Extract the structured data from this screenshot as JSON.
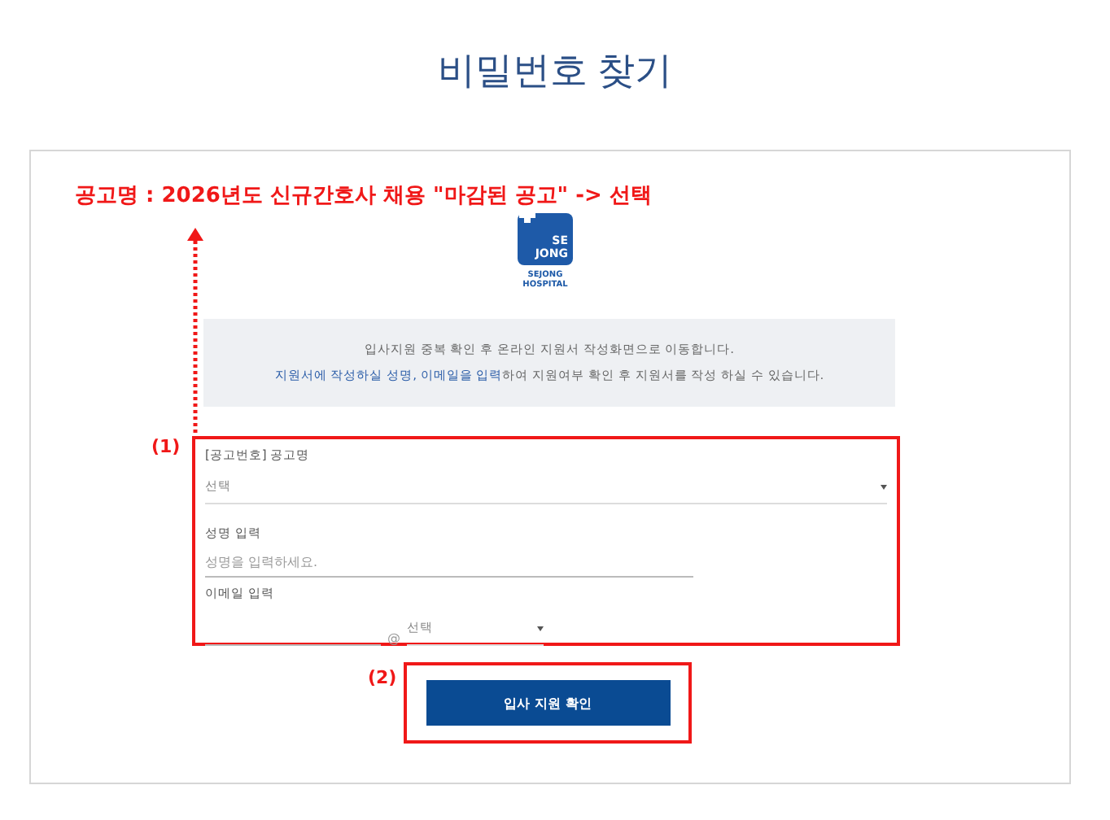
{
  "title": "비밀번호 찾기",
  "annotation": {
    "text": "공고명 : 2026년도 신규간호사 채용 \"마감된 공고\" -> 선택",
    "form_marker": "(1)",
    "button_marker": "(2)"
  },
  "logo": {
    "mark_lines": [
      "SE",
      "JONG"
    ],
    "name_lines": [
      "SEJONG",
      "HOSPITAL"
    ]
  },
  "notice": {
    "lines": [
      "입사지원 중복 확인 후 온라인 지원서 작성화면으로 이동합니다.",
      "**지원서에 작성하실 성명, 이메일을 입력**하여 지원여부 확인 후 지원서를 작성 하실 수 있습니다."
    ]
  },
  "posting": {
    "label": "[공고번호] 공고명",
    "value": "선택"
  },
  "name": {
    "label": "성명 입력",
    "placeholder": "성명을 입력하세요."
  },
  "email": {
    "label": "이메일 입력",
    "at": "@",
    "domain": "선택"
  },
  "button": "입사 지원 확인"
}
